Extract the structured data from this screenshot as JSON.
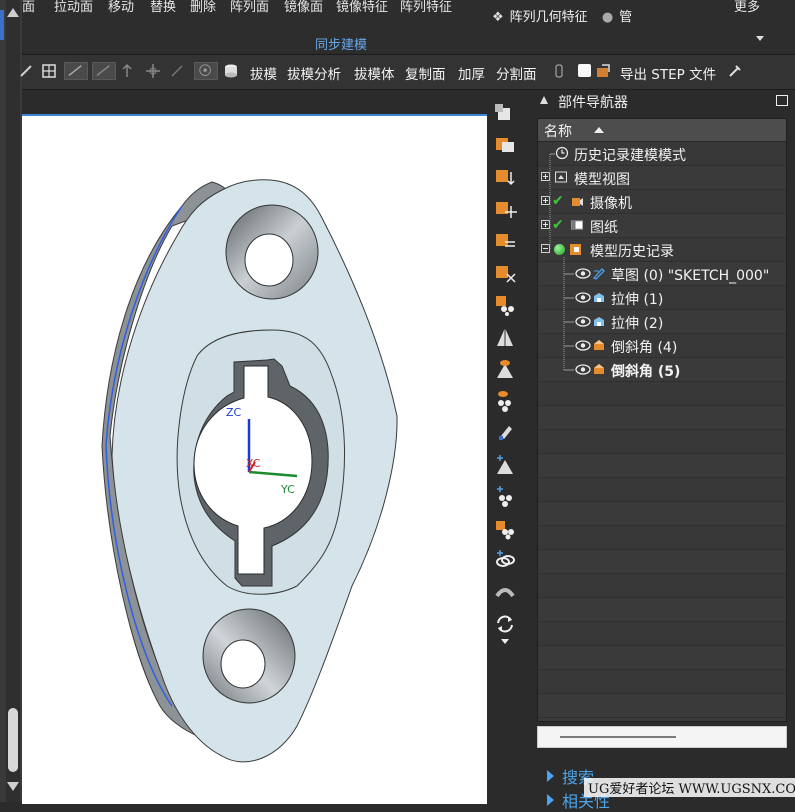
{
  "ribbon": {
    "top_labels": [
      "面",
      "拉动面",
      "移动",
      "替换",
      "删除",
      "阵列面",
      "镜像面",
      "镜像特征",
      "阵列特征"
    ],
    "more_label": "更多",
    "group_items": [
      "阵列几何特征",
      "管"
    ],
    "section_label": "同步建模"
  },
  "toolbar": {
    "draft": "拔模",
    "draft_analysis": "拔模分析",
    "draft_body": "拔模体",
    "copy_face": "复制面",
    "thicken": "加厚",
    "split_face": "分割面",
    "export_step": "导出 STEP 文件"
  },
  "viewport": {
    "axis_z": "ZC",
    "axis_x": "XC",
    "axis_y": "YC"
  },
  "navigator": {
    "title": "部件导航器",
    "column_header": "名称",
    "rows": [
      {
        "label": "历史记录建模模式"
      },
      {
        "label": "模型视图"
      },
      {
        "label": "摄像机"
      },
      {
        "label": "图纸"
      },
      {
        "label": "模型历史记录"
      },
      {
        "label": "草图 (0) \"SKETCH_000\""
      },
      {
        "label": "拉伸 (1)"
      },
      {
        "label": "拉伸 (2)"
      },
      {
        "label": "倒斜角 (4)"
      },
      {
        "label": "倒斜角 (5)"
      }
    ],
    "search_label": "搜索",
    "related_label": "相关性"
  },
  "watermark": "UG爱好者论坛 WWW.UGSNX.COM",
  "colors": {
    "accent": "#3e86d6",
    "part_fill": "#d4e4ea",
    "link": "#4da3ea",
    "check": "#3fc53f"
  }
}
